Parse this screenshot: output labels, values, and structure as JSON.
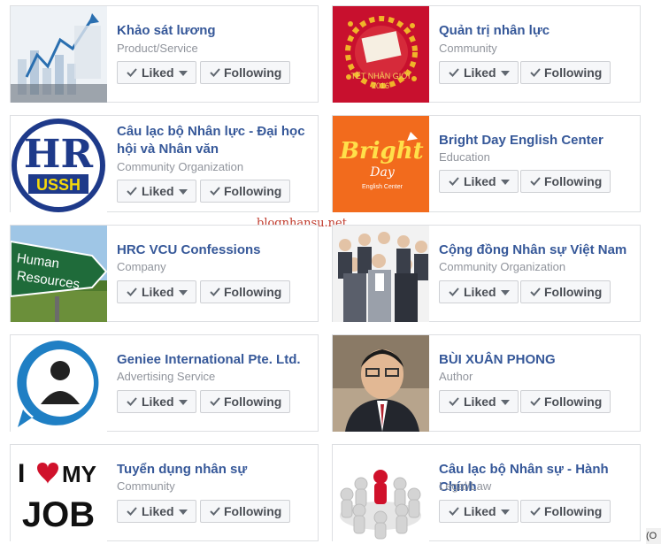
{
  "buttons": {
    "liked": "Liked",
    "following": "Following"
  },
  "watermark": "blognhansu.net",
  "corner_text": "(O",
  "pages": [
    {
      "title": "Khảo sát lương",
      "category": "Product/Service"
    },
    {
      "title": "Quản trị nhân lực",
      "category": "Community"
    },
    {
      "title": "Câu lạc bộ Nhân lực - Đại học hội và Nhân văn",
      "category": "Community Organization"
    },
    {
      "title": "Bright Day English Center",
      "category": "Education"
    },
    {
      "title": "HRC VCU Confessions",
      "category": "Company"
    },
    {
      "title": "Cộng đồng Nhân sự Việt Nam",
      "category": "Community Organization"
    },
    {
      "title": "Geniee International Pte. Ltd.",
      "category": "Advertising Service"
    },
    {
      "title": "BÙI XUÂN PHONG",
      "category": "Author"
    },
    {
      "title": "Tuyển dụng nhân sự",
      "category": "Community"
    },
    {
      "title": "Câu lạc bộ Nhân sự - Hành Chính",
      "category": "Legal/Law"
    }
  ],
  "thumbs": {
    "hr_logo_text": "HR",
    "ussh_text": "USSH",
    "bright_text": "Bright",
    "day_text": "Day",
    "bright_sub_text": "English Center",
    "sign_line1": "Human",
    "sign_line2": "Resources",
    "tet_text": "TẾT NHÂN GIỚI",
    "tet_year": "2016",
    "job_i": "I",
    "job_my": "MY",
    "job_job": "JOB"
  },
  "colors": {
    "link": "#365899",
    "meta": "#90949c",
    "button_bg": "#f6f7f9",
    "button_border": "#ced0d4"
  }
}
